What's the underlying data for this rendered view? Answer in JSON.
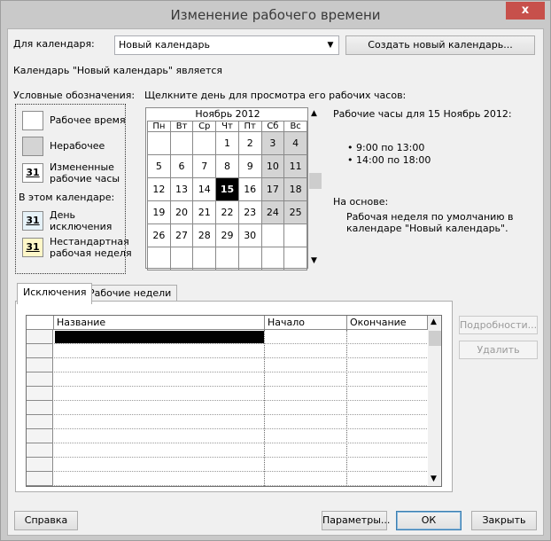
{
  "window": {
    "title": "Изменение рабочего времени",
    "close_glyph": "x"
  },
  "calendar_select": {
    "label": "Для календаря:",
    "value": "Новый календарь",
    "create_button": "Создать новый календарь..."
  },
  "status_text": "Календарь \"Новый календарь\" является",
  "legend": {
    "title": "Условные обозначения:",
    "items": [
      {
        "label": "Рабочее время",
        "color": "#ffffff"
      },
      {
        "label": "Нерабочее",
        "color": "#d4d4d4"
      },
      {
        "label_line1": "Измененные",
        "label_line2": "рабочие часы",
        "glyph": "31",
        "color": "#ffffff"
      }
    ],
    "in_calendar_title": "В этом календаре:",
    "in_calendar_items": [
      {
        "label_line1": "День",
        "label_line2": "исключения",
        "glyph": "31",
        "color": "#e6f2f8"
      },
      {
        "label_line1": "Нестандартная",
        "label_line2": "рабочая неделя",
        "glyph": "31",
        "color": "#fff7c8"
      }
    ]
  },
  "calendar": {
    "instruction": "Щелкните день для просмотра его рабочих часов:",
    "month_title": "Ноябрь 2012",
    "weekdays": [
      "Пн",
      "Вт",
      "Ср",
      "Чт",
      "Пт",
      "Сб",
      "Вс"
    ],
    "weeks": [
      [
        "",
        "",
        "",
        "1",
        "2",
        "3",
        "4"
      ],
      [
        "5",
        "6",
        "7",
        "8",
        "9",
        "10",
        "11"
      ],
      [
        "12",
        "13",
        "14",
        "15",
        "16",
        "17",
        "18"
      ],
      [
        "19",
        "20",
        "21",
        "22",
        "23",
        "24",
        "25"
      ],
      [
        "26",
        "27",
        "28",
        "29",
        "30",
        "",
        ""
      ],
      [
        "",
        "",
        "",
        "",
        "",
        "",
        ""
      ]
    ],
    "selected_day": "15",
    "scroll_up": "▲",
    "scroll_down": "▼"
  },
  "work_hours": {
    "title": "Рабочие часы для 15 Ноябрь 2012:",
    "slots": [
      "9:00 по 13:00",
      "14:00 по 18:00"
    ],
    "based_on_title": "На основе:",
    "based_on_line1": "Рабочая неделя по умолчанию в",
    "based_on_line2": "календаре \"Новый календарь\"."
  },
  "tabs": [
    {
      "label": "Исключения",
      "active": true
    },
    {
      "label": "Рабочие недели",
      "active": false
    }
  ],
  "exceptions_grid": {
    "columns": [
      "Название",
      "Начало",
      "Окончание"
    ],
    "row_count": 11,
    "scroll_up": "▲",
    "scroll_down": "▼"
  },
  "side_buttons": {
    "details": "Подробности...",
    "delete": "Удалить"
  },
  "footer": {
    "help": "Справка",
    "options": "Параметры...",
    "ok": "ОК",
    "close": "Закрыть"
  }
}
